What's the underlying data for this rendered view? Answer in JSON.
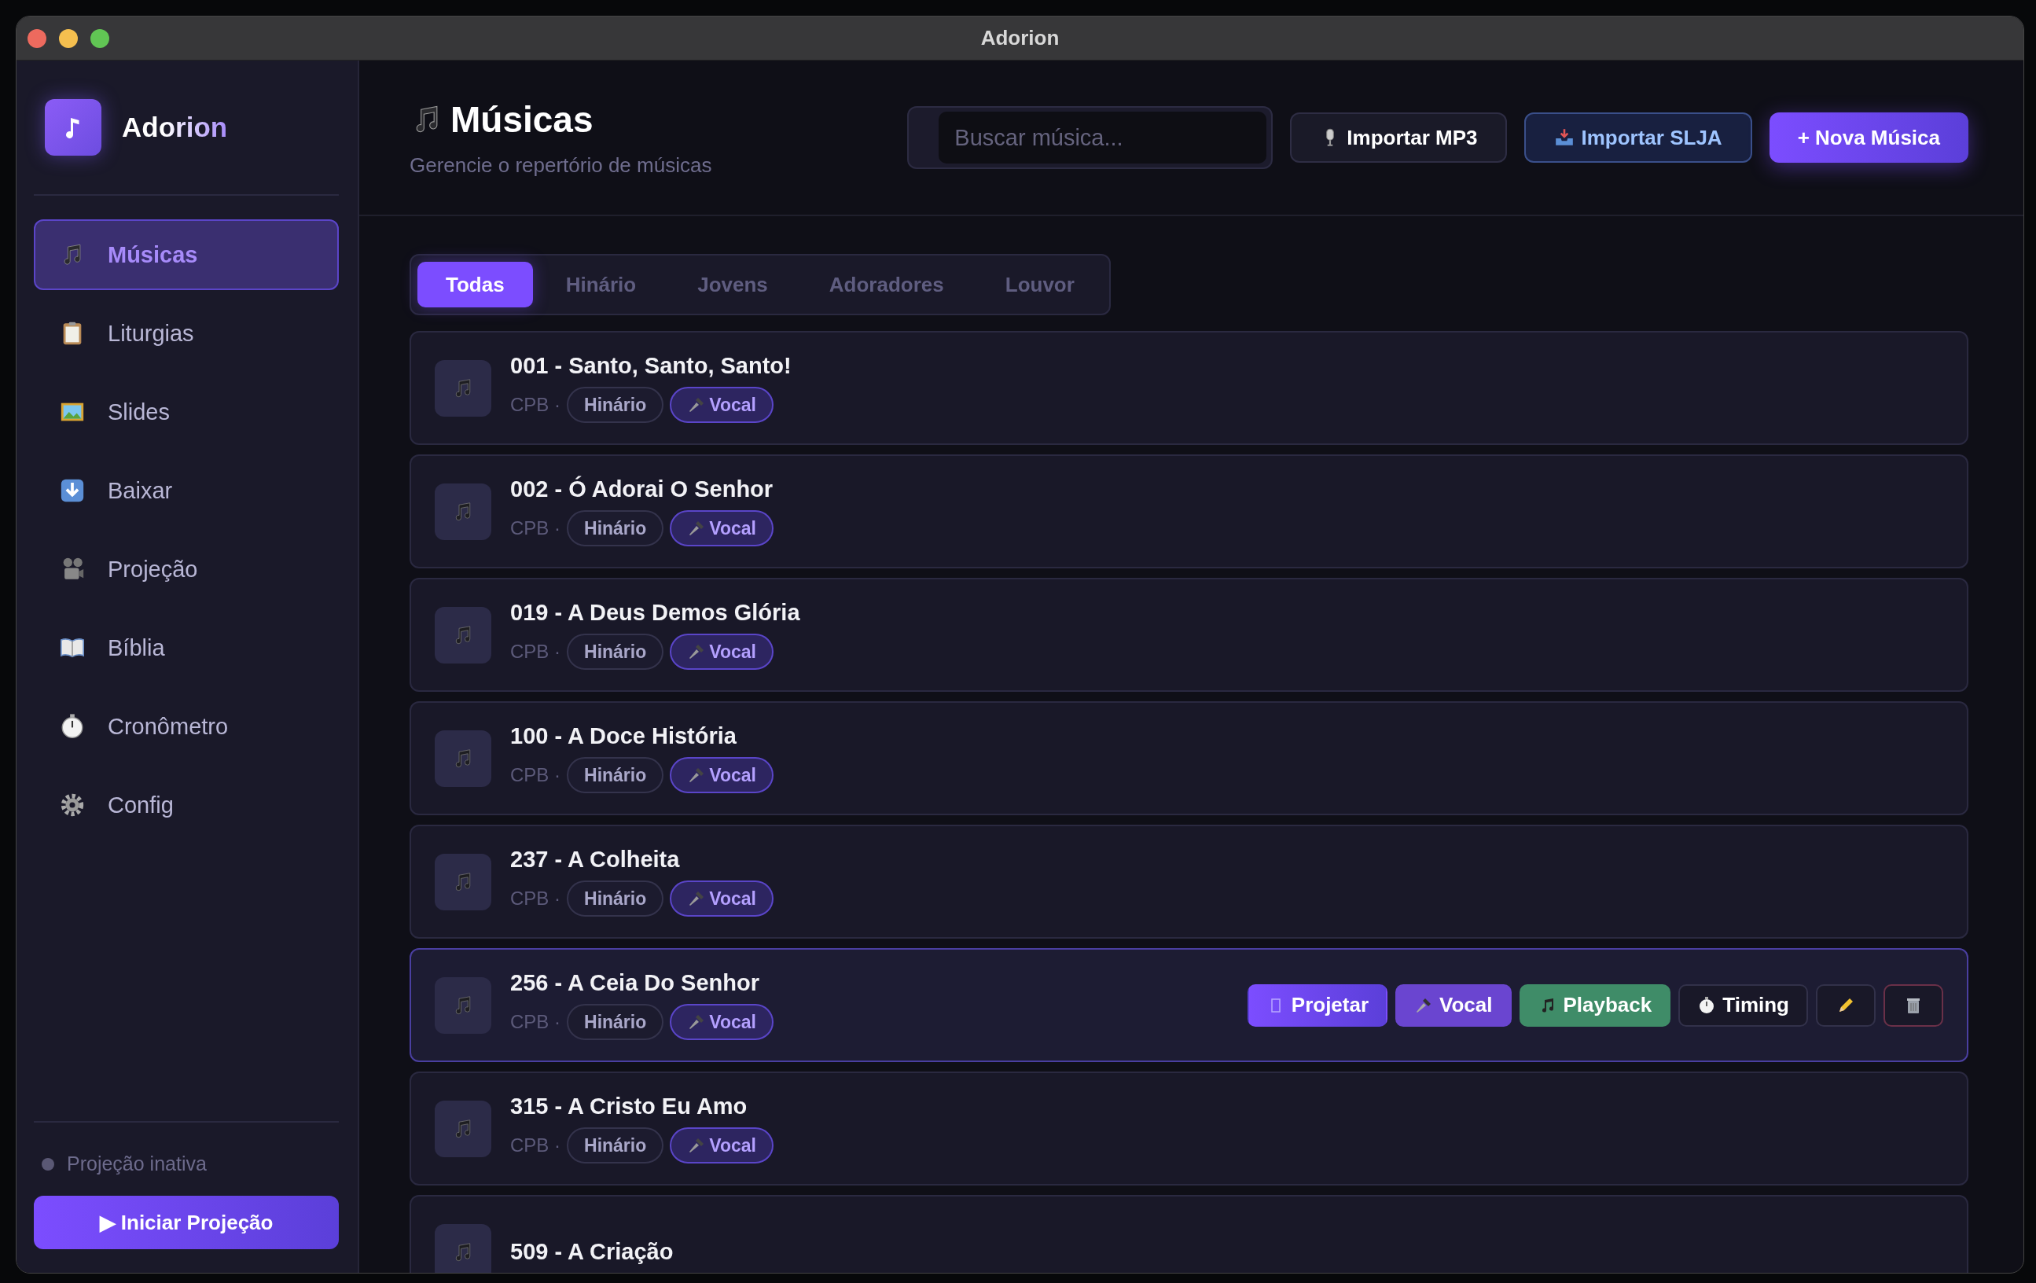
{
  "window": {
    "title": "Adorion"
  },
  "sidebar": {
    "brand": "Adorion",
    "items": [
      {
        "label": "Músicas",
        "kind": "music",
        "selected": true
      },
      {
        "label": "Liturgias",
        "kind": "clipboard",
        "selected": false
      },
      {
        "label": "Slides",
        "kind": "picture",
        "selected": false
      },
      {
        "label": "Baixar",
        "kind": "download",
        "selected": false
      },
      {
        "label": "Projeção",
        "kind": "projector",
        "selected": false
      },
      {
        "label": "Bíblia",
        "kind": "book",
        "selected": false
      },
      {
        "label": "Cronômetro",
        "kind": "stopwatch",
        "selected": false
      },
      {
        "label": "Config",
        "kind": "gear",
        "selected": false
      }
    ],
    "status": {
      "label": "Projeção inativa",
      "on": false
    },
    "start_button": "▶ Iniciar Projeção"
  },
  "header": {
    "title": "Músicas",
    "subtitle": "Gerencie o repertório de músicas",
    "search": {
      "placeholder": "Buscar música..."
    },
    "buttons": [
      {
        "label": "Importar MP3",
        "kind": "mp3"
      },
      {
        "label": "Importar SLJA",
        "kind": "slja"
      },
      {
        "label": "+ Nova Música",
        "kind": "primary"
      }
    ]
  },
  "tabs": [
    {
      "label": "Todas",
      "selected": true
    },
    {
      "label": "Hinário",
      "selected": false
    },
    {
      "label": "Jovens",
      "selected": false
    },
    {
      "label": "Adoradores",
      "selected": false
    },
    {
      "label": "Louvor",
      "selected": false
    }
  ],
  "songs": [
    {
      "title": "001 - Santo, Santo, Santo!",
      "source": "CPB ·",
      "tags": [
        {
          "label": "Hinário",
          "kind": "category"
        },
        {
          "label": "Vocal",
          "kind": "vocal"
        }
      ],
      "selected": false
    },
    {
      "title": "002 - Ó Adorai O Senhor",
      "source": "CPB ·",
      "tags": [
        {
          "label": "Hinário",
          "kind": "category"
        },
        {
          "label": "Vocal",
          "kind": "vocal"
        }
      ],
      "selected": false
    },
    {
      "title": "019 - A Deus Demos Glória",
      "source": "CPB ·",
      "tags": [
        {
          "label": "Hinário",
          "kind": "category"
        },
        {
          "label": "Vocal",
          "kind": "vocal"
        }
      ],
      "selected": false
    },
    {
      "title": "100 - A Doce História",
      "source": "CPB ·",
      "tags": [
        {
          "label": "Hinário",
          "kind": "category"
        },
        {
          "label": "Vocal",
          "kind": "vocal"
        }
      ],
      "selected": false
    },
    {
      "title": "237 - A Colheita",
      "source": "CPB ·",
      "tags": [
        {
          "label": "Hinário",
          "kind": "category"
        },
        {
          "label": "Vocal",
          "kind": "vocal"
        }
      ],
      "selected": false
    },
    {
      "title": "256 - A Ceia Do Senhor",
      "source": "CPB ·",
      "tags": [
        {
          "label": "Hinário",
          "kind": "category"
        },
        {
          "label": "Vocal",
          "kind": "vocal"
        }
      ],
      "selected": true
    },
    {
      "title": "315 - A Cristo Eu Amo",
      "source": "CPB ·",
      "tags": [
        {
          "label": "Hinário",
          "kind": "category"
        },
        {
          "label": "Vocal",
          "kind": "vocal"
        }
      ],
      "selected": false
    },
    {
      "title": "509 - A Criação",
      "selected": false
    }
  ],
  "row_actions": [
    {
      "label": "Projetar",
      "kind": "projetar"
    },
    {
      "label": "Vocal",
      "kind": "vocal"
    },
    {
      "label": "Playback",
      "kind": "playback"
    },
    {
      "label": "Timing",
      "kind": "timing"
    },
    {
      "kind": "edit"
    },
    {
      "kind": "delete"
    }
  ]
}
